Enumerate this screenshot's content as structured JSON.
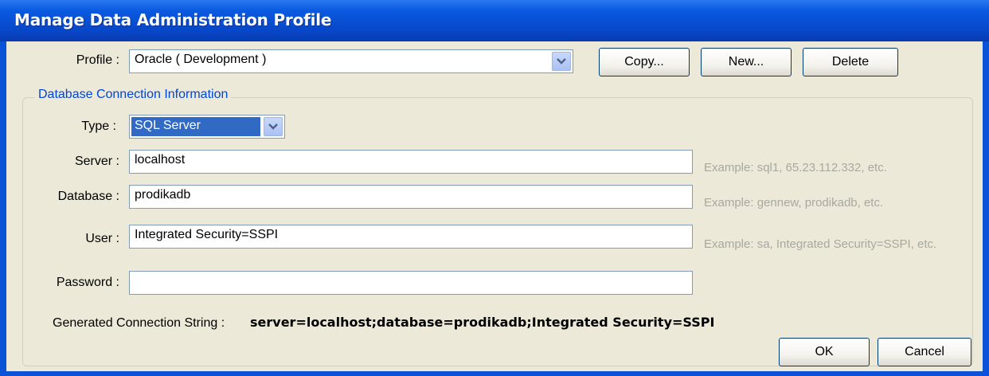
{
  "window": {
    "title": "Manage Data Administration Profile"
  },
  "profile": {
    "label": "Profile :",
    "selected": "Oracle ( Development )"
  },
  "buttons": {
    "copy": "Copy...",
    "new": "New...",
    "delete": "Delete",
    "ok": "OK",
    "cancel": "Cancel"
  },
  "group": {
    "legend": "Database Connection Information"
  },
  "type": {
    "label": "Type :",
    "selected": "SQL Server"
  },
  "server": {
    "label": "Server :",
    "value": "localhost",
    "hint": "Example: sql1, 65.23.112.332, etc."
  },
  "database": {
    "label": "Database :",
    "value": "prodikadb",
    "hint": "Example: gennew, prodikadb, etc."
  },
  "user": {
    "label": "User :",
    "value": "Integrated Security=SSPI",
    "hint": "Example: sa, Integrated Security=SSPI, etc."
  },
  "password": {
    "label": "Password :",
    "value": ""
  },
  "connection": {
    "label": "Generated Connection String :",
    "value": "server=localhost;database=prodikadb;Integrated Security=SSPI"
  },
  "icons": {
    "dropdown": "chevron-down-icon"
  }
}
